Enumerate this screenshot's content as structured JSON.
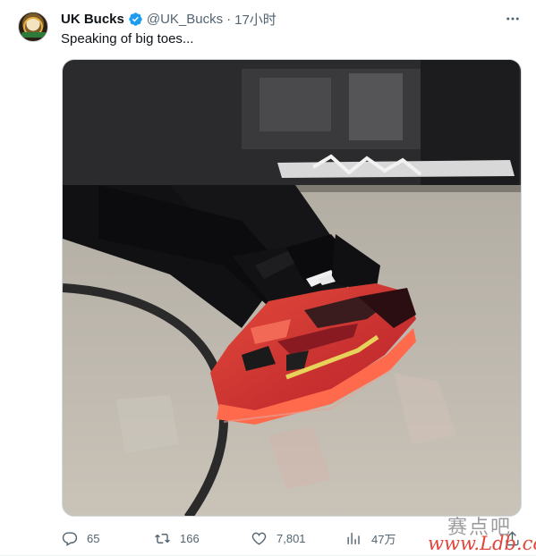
{
  "tweet": {
    "display_name": "UK Bucks",
    "handle": "@UK_Bucks",
    "separator": "·",
    "time": "17小时",
    "text": "Speaking of big toes...",
    "verified_color": "#1d9bf0",
    "media": {
      "kind": "photo",
      "subject": "red-nike-basketball-shoe",
      "icon": "photo-media"
    }
  },
  "actions": {
    "reply_count": "65",
    "retweet_count": "166",
    "like_count": "7,801",
    "views_count": "47万"
  },
  "icons": {
    "more": "more-icon",
    "reply": "reply-icon",
    "retweet": "retweet-icon",
    "like": "like-icon",
    "views": "views-icon",
    "share": "share-icon"
  },
  "watermark": {
    "logo_text": "赛点吧",
    "url": "www.Ldb.cc",
    "url_color": "#e0443a"
  }
}
